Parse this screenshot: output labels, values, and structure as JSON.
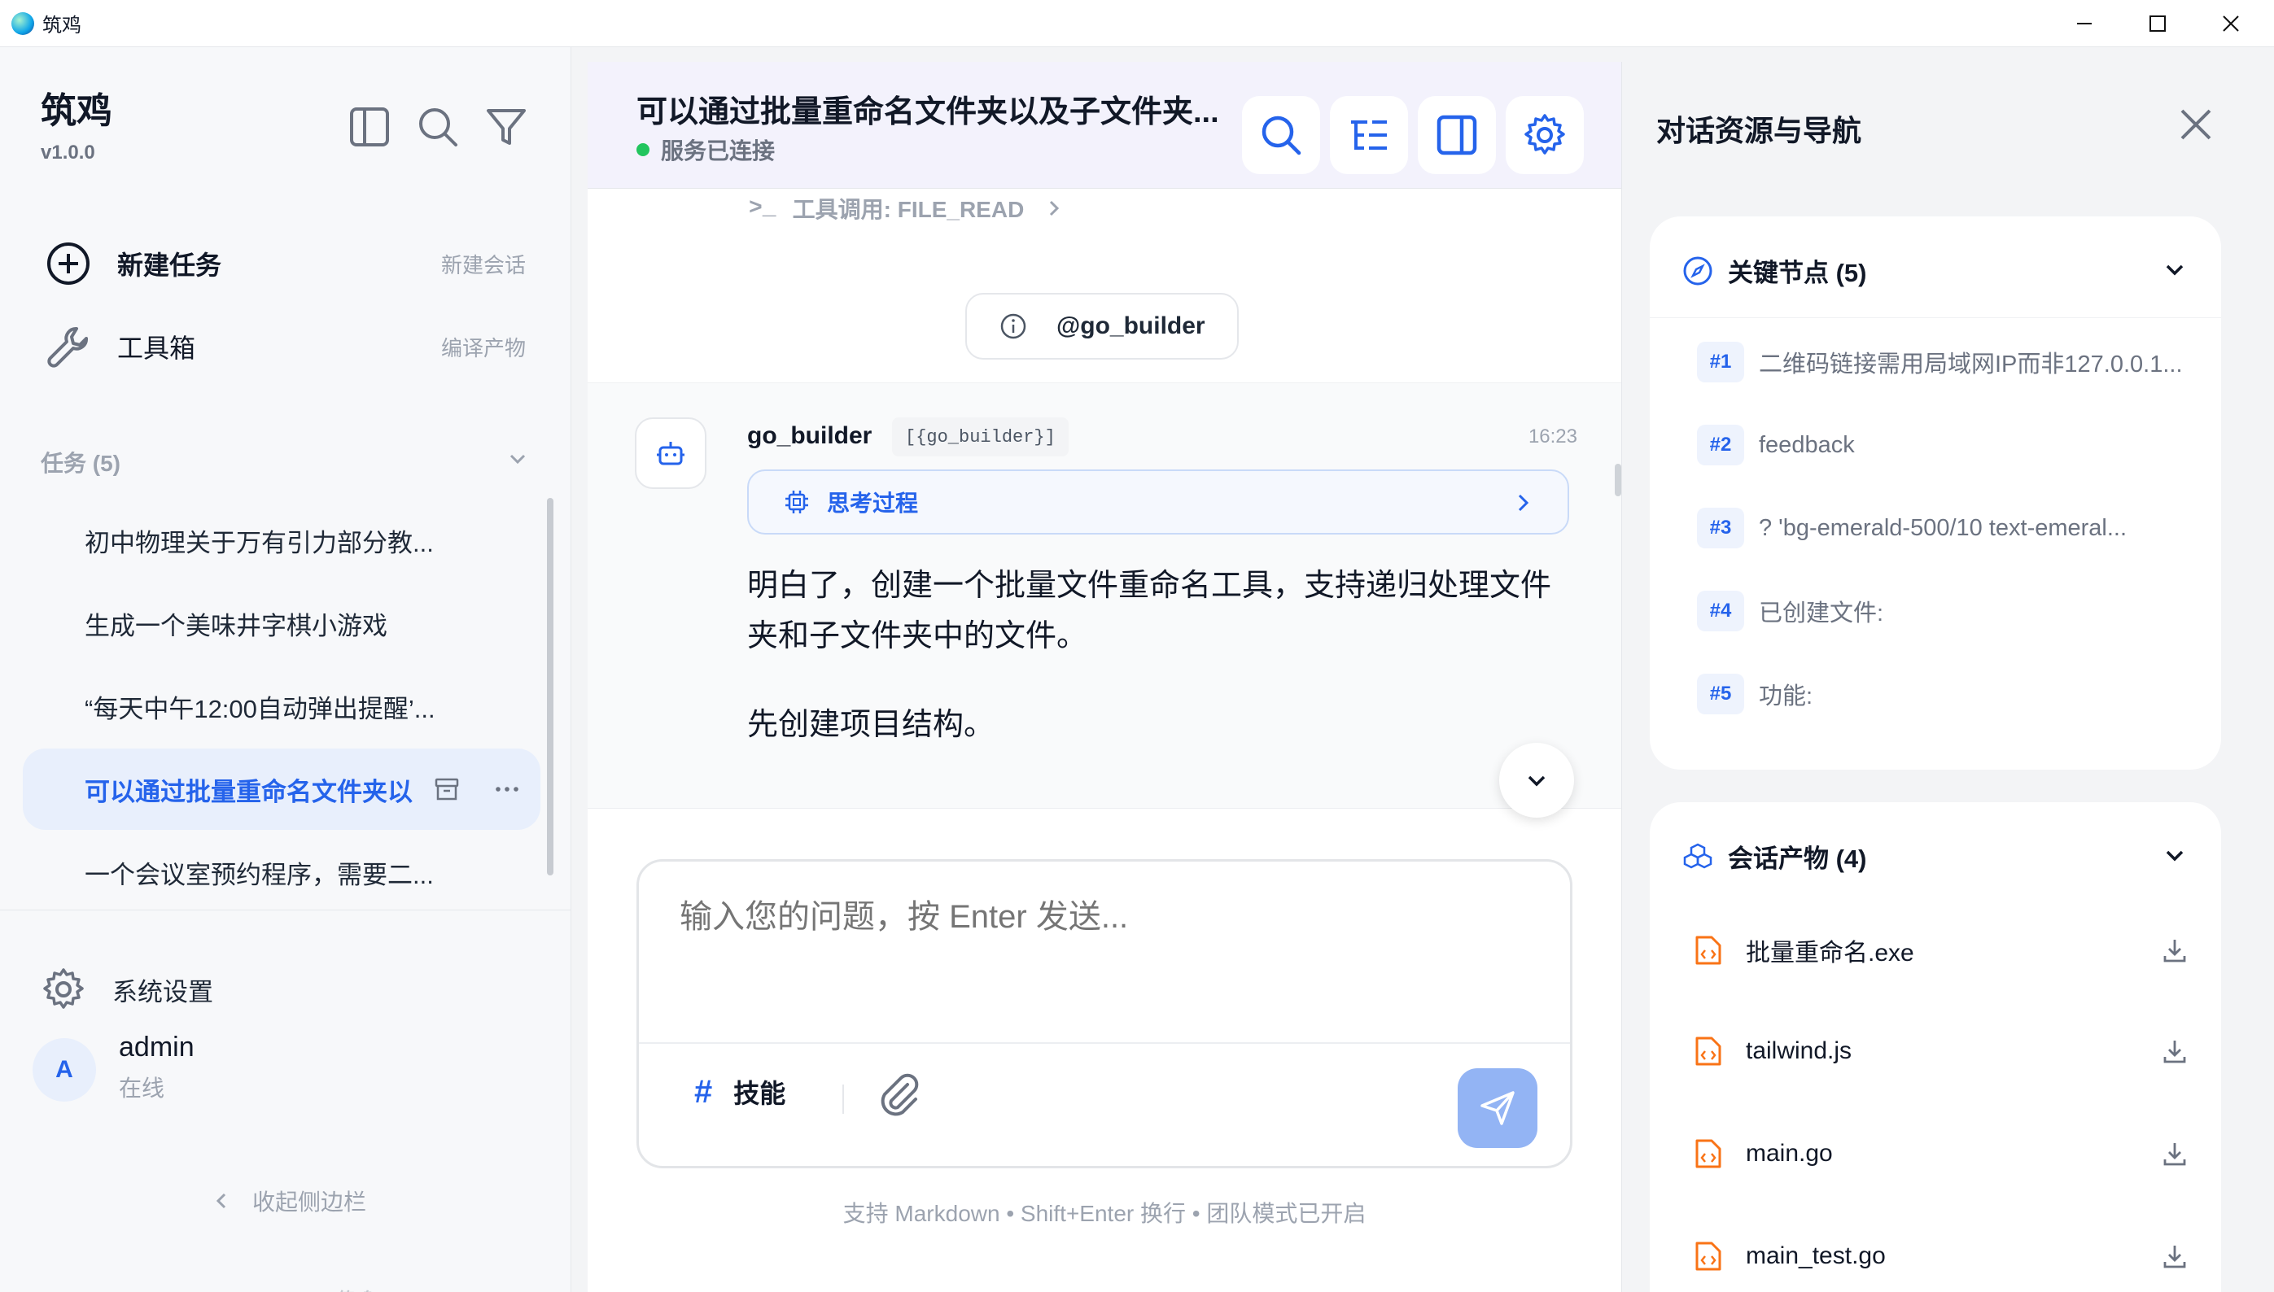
{
  "window": {
    "title": "筑鸡",
    "controls": [
      "minimize",
      "maximize",
      "close"
    ]
  },
  "sidebar": {
    "brand_name": "筑鸡",
    "version": "v1.0.0",
    "tools": [
      "sidebar-toggle-icon",
      "search-icon",
      "filter-icon"
    ],
    "new_task": {
      "label": "新建任务",
      "hint": "新建会话",
      "icon": "plus-circle-icon"
    },
    "toolbox": {
      "label": "工具箱",
      "hint": "编译产物",
      "icon": "wrench-icon"
    },
    "tasks_header": "任务 (5)",
    "tasks": [
      {
        "label": "初中物理关于万有引力部分教..."
      },
      {
        "label": "生成一个美味井字棋小游戏"
      },
      {
        "label": "“每天中午12:00自动弹出提醒’..."
      },
      {
        "label": "可以通过批量重命名文件夹以"
      },
      {
        "label": "一个会议室预约程序，需要二..."
      }
    ],
    "active_task_index": 3,
    "settings_label": "系统设置",
    "user": {
      "avatar_letter": "A",
      "name": "admin",
      "status": "在线"
    },
    "collapse_label": "收起侧边栏",
    "powered_by": "POWERED BY 筑鸡"
  },
  "main": {
    "title": "可以通过批量重命名文件夹以及子文件夹...",
    "connection_status": "服务已连接",
    "header_buttons": [
      "search-icon",
      "outline-icon",
      "panel-icon",
      "gear-icon"
    ],
    "tool_call": "工具调用: FILE_READ",
    "mention": "@go_builder",
    "message": {
      "author": "go_builder",
      "tag": "[{go_builder}]",
      "time": "16:23",
      "thinking_label": "思考过程",
      "text1": "明白了，创建一个批量文件重命名工具，支持递归处理文件夹和子文件夹中的文件。",
      "text2": "先创建项目结构。"
    },
    "composer": {
      "placeholder": "输入您的问题，按 Enter 发送...",
      "skills_label": "技能",
      "skills_symbol": "#"
    },
    "footer_hint": "支持 Markdown • Shift+Enter 换行 • 团队模式已开启"
  },
  "rpanel": {
    "title": "对话资源与导航",
    "nodes_header": "关键节点 (5)",
    "nodes": [
      {
        "badge": "#1",
        "text": "二维码链接需用局域网IP而非127.0.0.1..."
      },
      {
        "badge": "#2",
        "text": "feedback"
      },
      {
        "badge": "#3",
        "text": "? 'bg-emerald-500/10 text-emeral..."
      },
      {
        "badge": "#4",
        "text": "已创建文件:"
      },
      {
        "badge": "#5",
        "text": "功能:"
      }
    ],
    "artifacts_header": "会话产物 (4)",
    "artifacts": [
      {
        "name": "批量重命名.exe"
      },
      {
        "name": "tailwind.js"
      },
      {
        "name": "main.go"
      },
      {
        "name": "main_test.go"
      }
    ]
  },
  "colors": {
    "accent": "#2563eb",
    "status_green": "#22c55e",
    "file_icon": "#f97316",
    "send_button": "#93b4f4"
  }
}
